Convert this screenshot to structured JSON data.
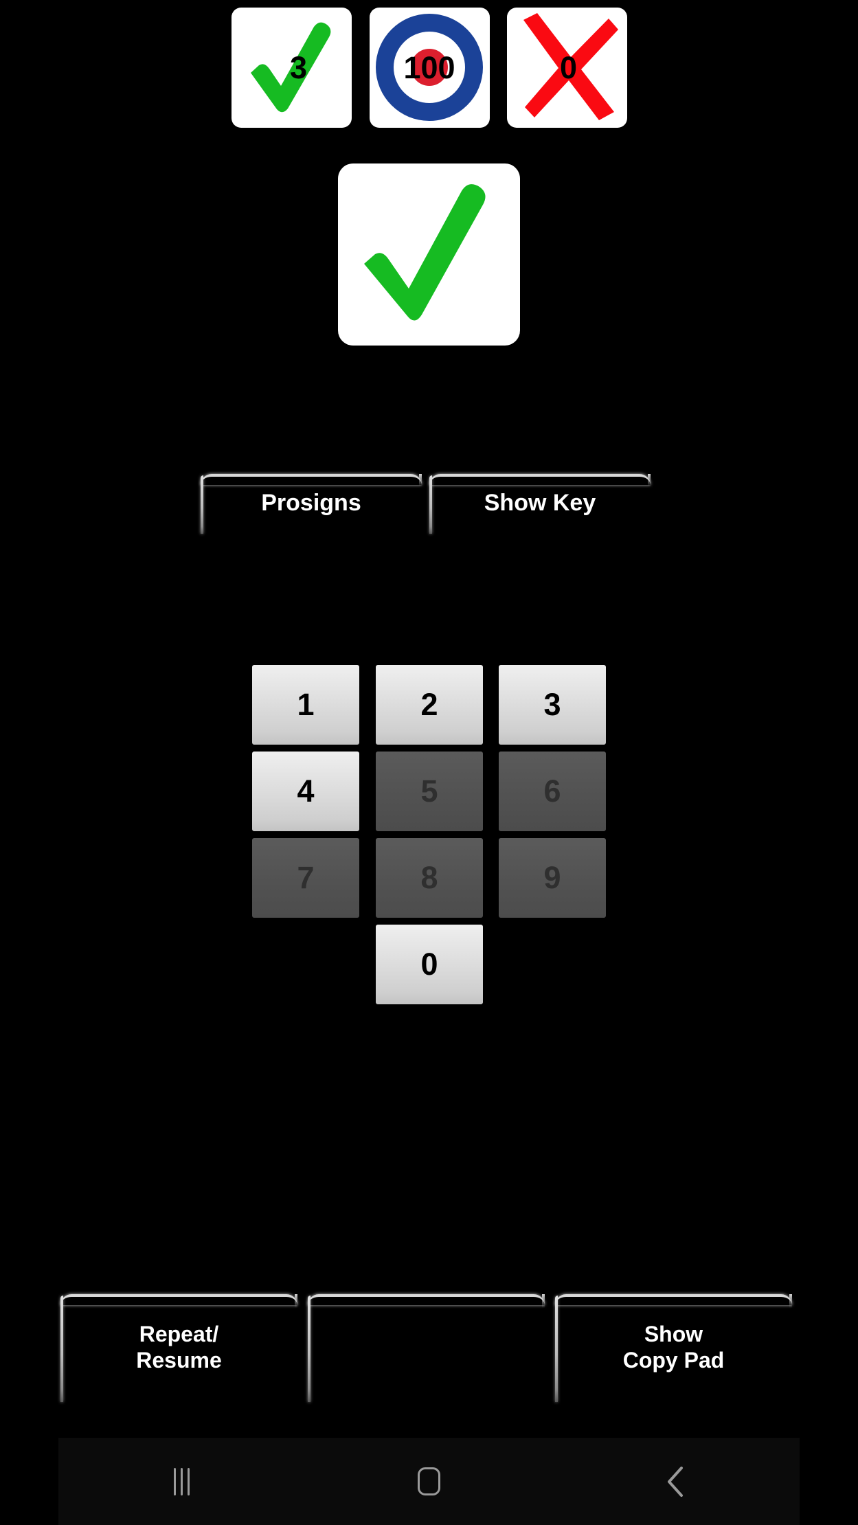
{
  "app": {
    "background_color": "#000000",
    "accent_enabled_key": "#e2e2e2",
    "accent_disabled_key": "#525252",
    "glow_color": "#d8d8d8"
  },
  "status_row": {
    "correct": {
      "icon": "green-check-icon",
      "value": "3",
      "color": "#16bb22"
    },
    "score": {
      "icon": "target-bullseye-icon",
      "value": "100",
      "ring_color": "#1b4298",
      "center_color": "#dc1f2e"
    },
    "wrong": {
      "icon": "red-x-icon",
      "value": "0",
      "color": "#fa0a12"
    }
  },
  "feedback": {
    "icon": "green-check-icon",
    "color": "#16bb22",
    "card_color": "#ffffff"
  },
  "top_buttons": [
    {
      "label": "Prosigns",
      "name": "prosigns-button"
    },
    {
      "label": "Show Key",
      "name": "show-key-button"
    }
  ],
  "keypad": {
    "keys": [
      {
        "label": "1",
        "enabled": true
      },
      {
        "label": "2",
        "enabled": true
      },
      {
        "label": "3",
        "enabled": true
      },
      {
        "label": "4",
        "enabled": true
      },
      {
        "label": "5",
        "enabled": false
      },
      {
        "label": "6",
        "enabled": false
      },
      {
        "label": "7",
        "enabled": false
      },
      {
        "label": "8",
        "enabled": false
      },
      {
        "label": "9",
        "enabled": false
      },
      {
        "label": "0",
        "enabled": true
      }
    ]
  },
  "bottom_buttons": [
    {
      "label": "Repeat/\nResume",
      "name": "repeat-resume-button"
    },
    {
      "label": "",
      "name": "middle-blank-button"
    },
    {
      "label": "Show\nCopy Pad",
      "name": "show-copy-pad-button"
    }
  ],
  "navbar": {
    "recents_label": "Recents",
    "home_label": "Home",
    "back_label": "Back",
    "icon_color": "#9a9a9a"
  }
}
